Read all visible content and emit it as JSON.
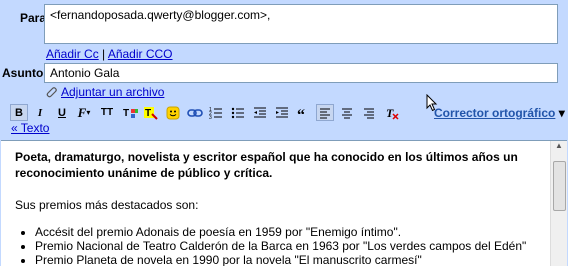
{
  "compose": {
    "to_label": "Para:",
    "to_value": "<fernandoposada.qwerty@blogger.com>,",
    "add_cc": "Añadir Cc",
    "separator": "|",
    "add_bcc": "Añadir CCO",
    "subject_label": "Asunto:",
    "subject_value": "Antonio Gala",
    "attach": "Adjuntar un archivo"
  },
  "toolbar": {
    "bold": "B",
    "italic": "I",
    "underline": "U",
    "font": "F",
    "size": "TT",
    "spellcheck": "Corrector ortográfico",
    "spellcheck_arrow": "▾",
    "plain_text": "« Texto"
  },
  "body": {
    "heading": "Poeta, dramaturgo, novelista y escritor español que ha conocido en los últimos años un reconocimiento unánime de público y crítica.",
    "intro": "Sus premios más destacados son:",
    "awards": [
      "Accésit del premio Adonais de poesía en 1959 por \"Enemigo íntimo\".",
      "Premio Nacional de Teatro Calderón de la Barca en 1963 por \"Los verdes campos del Edén\"",
      "Premio Planeta de novela en 1990 por la novela \"El manuscrito carmesí\""
    ]
  }
}
